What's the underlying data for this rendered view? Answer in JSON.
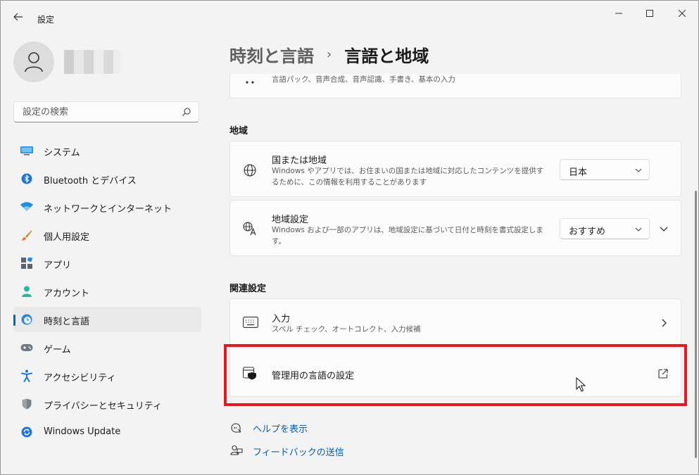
{
  "window": {
    "app_title": "設定",
    "controls": {
      "minimize": "minimize",
      "maximize": "maximize",
      "close": "close"
    }
  },
  "search": {
    "placeholder": "設定の検索"
  },
  "sidebar": {
    "items": [
      {
        "label": "システム",
        "icon": "system-icon"
      },
      {
        "label": "Bluetooth とデバイス",
        "icon": "bluetooth-icon"
      },
      {
        "label": "ネットワークとインターネット",
        "icon": "network-icon"
      },
      {
        "label": "個人用設定",
        "icon": "brush-icon"
      },
      {
        "label": "アプリ",
        "icon": "apps-icon"
      },
      {
        "label": "アカウント",
        "icon": "account-icon"
      },
      {
        "label": "時刻と言語",
        "icon": "time-language-icon",
        "selected": true
      },
      {
        "label": "ゲーム",
        "icon": "gaming-icon"
      },
      {
        "label": "アクセシビリティ",
        "icon": "accessibility-icon"
      },
      {
        "label": "プライバシーとセキュリティ",
        "icon": "shield-icon"
      },
      {
        "label": "Windows Update",
        "icon": "update-icon"
      }
    ]
  },
  "breadcrumb": {
    "parent": "時刻と言語",
    "separator": "›",
    "current": "言語と地域"
  },
  "language_card": {
    "desc": "言語パック、音声合成、音声認識、手書き、基本の入力"
  },
  "region_section": {
    "heading": "地域",
    "country": {
      "title": "国または地域",
      "desc": "Windows やアプリでは、お住まいの国または地域に対応したコンテンツを提供するために、この情報を利用することがあります",
      "value": "日本"
    },
    "regional_format": {
      "title": "地域設定",
      "desc": "Windows および一部のアプリは、地域設定に基づいて日付と時刻を書式設定します。",
      "value": "おすすめ"
    }
  },
  "related_section": {
    "heading": "関連設定",
    "typing": {
      "title": "入力",
      "desc": "スペル チェック、オートコレクト、入力候補"
    },
    "admin_language": {
      "title": "管理用の言語の設定"
    }
  },
  "footer": {
    "help": "ヘルプを表示",
    "feedback": "フィードバックの送信"
  },
  "colors": {
    "accent": "#0067c0",
    "highlight": "#e01b24",
    "link": "#0b5cad"
  }
}
